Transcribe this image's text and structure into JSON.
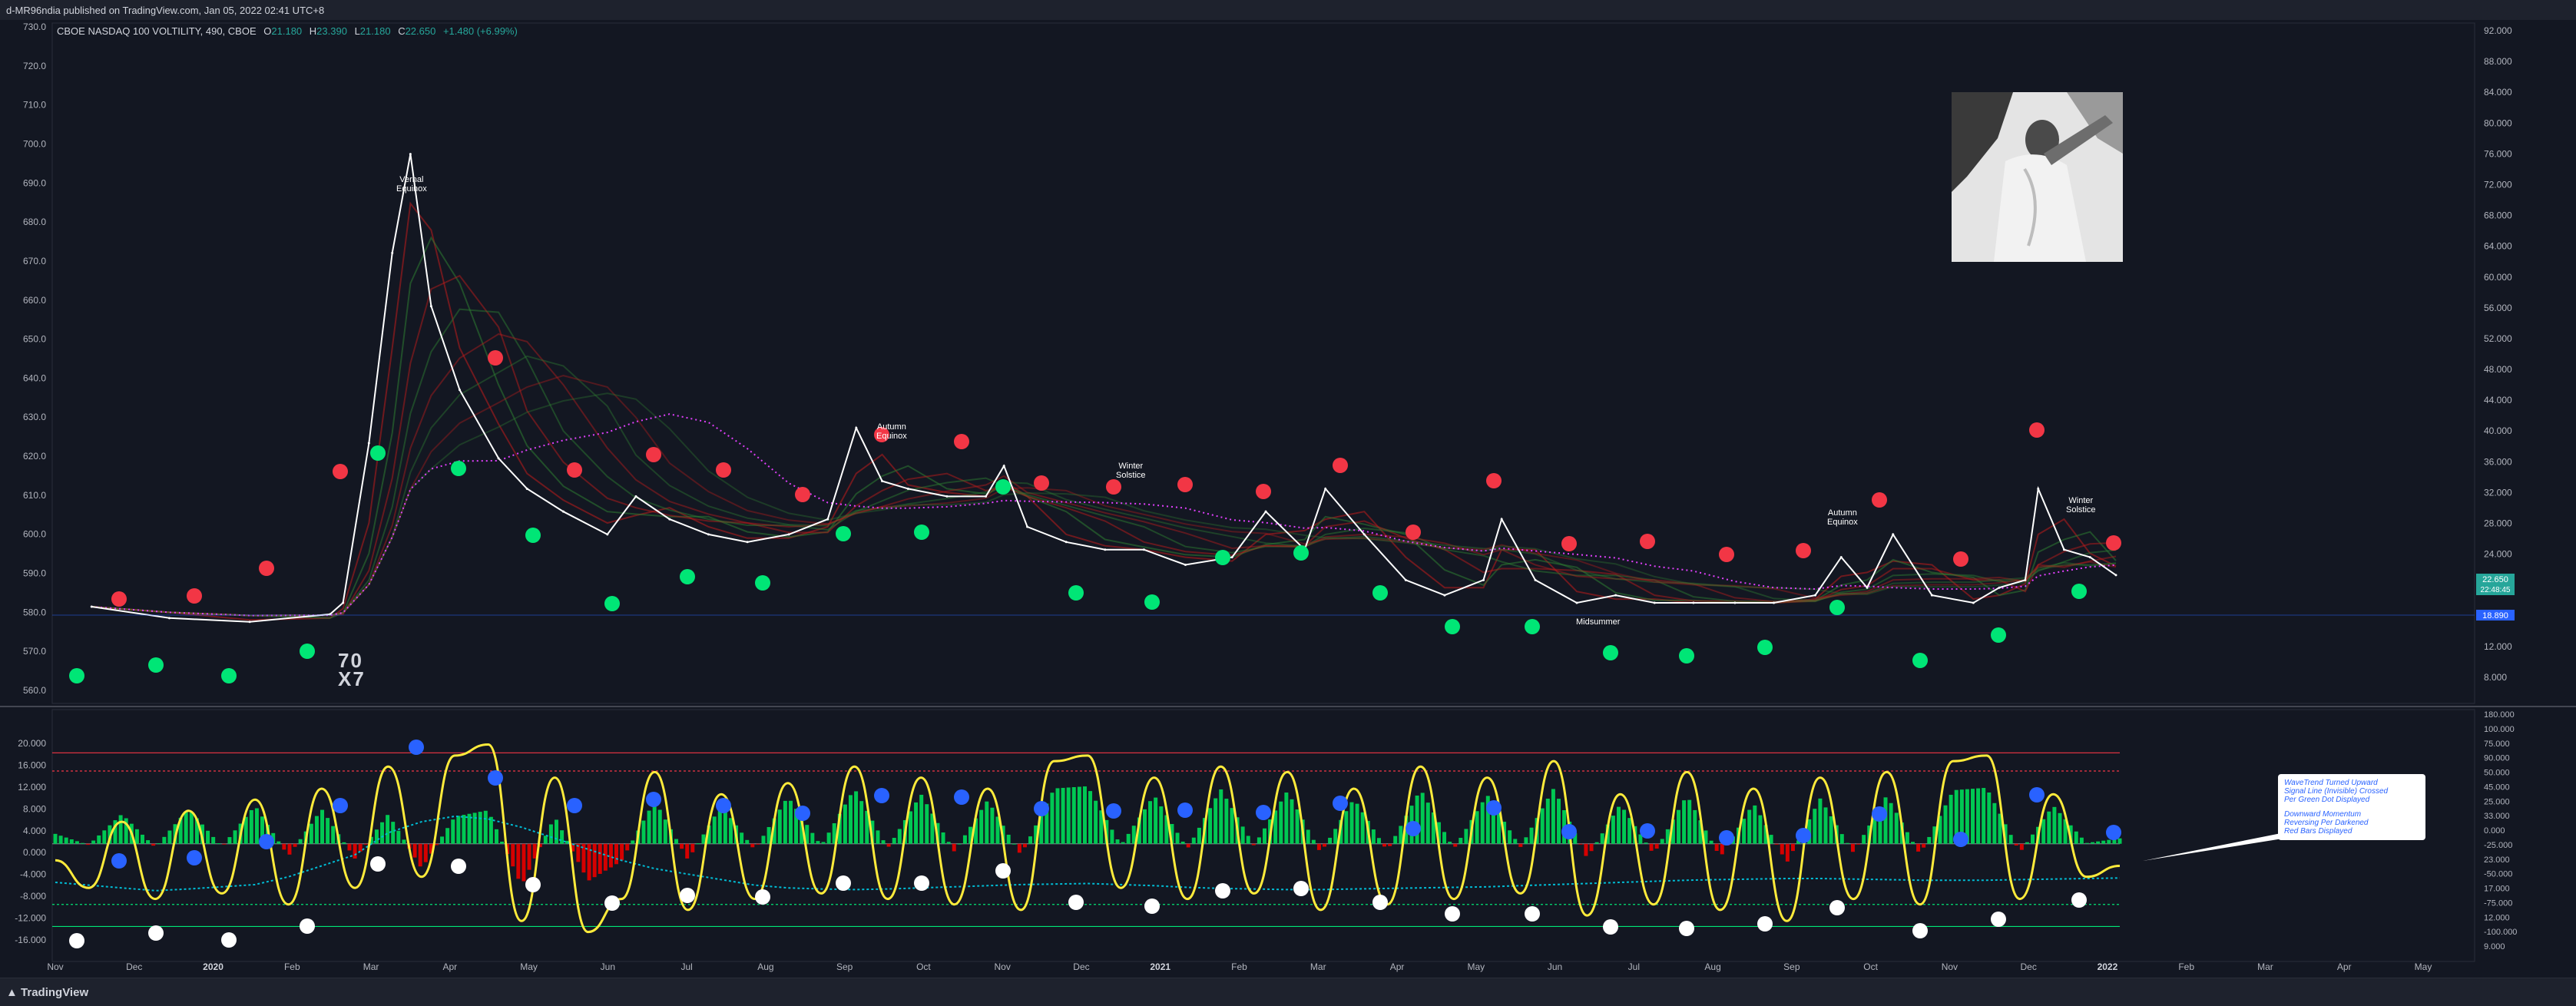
{
  "publisher": "d-MR96ndia published on TradingView.com, Jan 05, 2022 02:41 UTC+8",
  "logo_text": "TradingView",
  "legend": {
    "title": "CBOE NASDAQ 100 VOLTILITY, 490, CBOE",
    "o_label": "O",
    "o_value": "21.180",
    "h_label": "H",
    "h_value": "23.390",
    "l_label": "L",
    "l_value": "21.180",
    "c_label": "C",
    "c_value": "22.650",
    "change": "+1.480 (+6.99%)"
  },
  "watermark": "70\nX7",
  "annotations": {
    "vernal": "Vernal\nEquinox",
    "autumn1": "Autumn\nEquinox",
    "winter1": "Winter\nSolstice",
    "midsummer": "Midsummer",
    "autumn2": "Autumn\nEquinox",
    "winter2": "Winter\nSolstice"
  },
  "callout": {
    "line1": "WaveTrend Turned Upward",
    "line2": "Signal Line (Invisible) Crossed",
    "line3": "Per Green Dot Displayed",
    "line4": "Downward Momentum",
    "line5": "Reversing Per Darkened",
    "line6": "Red Bars Displayed"
  },
  "price_badges": {
    "last": "22.650",
    "timer": "22:48:45",
    "ma": "18.890"
  },
  "colors": {
    "background": "#131722",
    "price_line": "#ffffff",
    "bull": "#26a69a",
    "red_dot": "#f23645",
    "green_dot": "#00e676",
    "blue_dot": "#2962ff",
    "wave": "#ffeb3b",
    "signal": "#00bcd4",
    "ma_dotted": "#e040fb"
  },
  "chart_data": [
    {
      "type": "line",
      "title": "CBOE NASDAQ 100 VOLTILITY, 490, CBOE",
      "x_ticks": [
        "Nov",
        "Dec",
        "2020",
        "Feb",
        "Mar",
        "Apr",
        "May",
        "Jun",
        "Jul",
        "Aug",
        "Sep",
        "Oct",
        "Nov",
        "Dec",
        "2021",
        "Feb",
        "Mar",
        "Apr",
        "May",
        "Jun",
        "Jul",
        "Aug",
        "Sep",
        "Oct",
        "Nov",
        "Dec",
        "2022",
        "Feb",
        "Mar",
        "Apr",
        "May"
      ],
      "left_axis_ticks": [
        "730.0",
        "720.0",
        "710.0",
        "700.0",
        "690.0",
        "680.0",
        "670.0",
        "660.0",
        "650.0",
        "640.0",
        "630.0",
        "620.0",
        "610.0",
        "600.0",
        "590.0",
        "580.0",
        "570.0",
        "560.0"
      ],
      "right_axis_ticks": [
        "92.000",
        "88.000",
        "84.000",
        "80.000",
        "76.000",
        "72.000",
        "68.000",
        "64.000",
        "60.000",
        "56.000",
        "52.000",
        "48.000",
        "44.000",
        "40.000",
        "36.000",
        "32.000",
        "28.000",
        "24.000",
        "20.000",
        "16.000",
        "12.000",
        "8.000"
      ],
      "ylim": [
        8,
        93
      ],
      "series": [
        {
          "x": [
            "2019-11",
            "2019-12",
            "2020-01",
            "2020-02",
            "2020-02-20",
            "2020-03-01",
            "2020-03-10",
            "2020-03-17",
            "2020-03-25",
            "2020-04-05",
            "2020-04-20",
            "2020-05-01",
            "2020-05-15",
            "2020-06-01",
            "2020-06-12",
            "2020-06-25",
            "2020-07-10",
            "2020-07-25",
            "2020-08-10",
            "2020-08-25",
            "2020-09-05",
            "2020-09-15",
            "2020-09-25",
            "2020-10-10",
            "2020-10-25",
            "2020-11-01",
            "2020-11-10",
            "2020-11-25",
            "2020-12-10",
            "2020-12-25",
            "2021-01-10",
            "2021-01-28",
            "2021-02-10",
            "2021-02-25",
            "2021-03-05",
            "2021-03-20",
            "2021-04-05",
            "2021-04-20",
            "2021-05-05",
            "2021-05-12",
            "2021-05-25",
            "2021-06-10",
            "2021-06-25",
            "2021-07-10",
            "2021-07-25",
            "2021-08-10",
            "2021-08-25",
            "2021-09-10",
            "2021-09-20",
            "2021-09-30",
            "2021-10-10",
            "2021-10-25",
            "2021-11-10",
            "2021-11-20",
            "2021-11-30",
            "2021-12-05",
            "2021-12-15",
            "2021-12-25",
            "2022-01-04"
          ],
          "y": [
            18.5,
            17,
            16.5,
            17.5,
            19,
            40,
            65,
            78,
            58,
            47,
            38,
            34,
            31,
            28,
            33,
            30,
            28,
            27,
            28,
            30,
            42,
            35,
            34,
            33,
            33,
            37,
            29,
            27,
            26,
            26,
            24,
            25,
            31,
            26,
            34,
            28,
            22,
            20,
            22,
            30,
            22,
            19,
            20,
            19,
            19,
            19,
            19,
            20,
            25,
            21,
            28,
            20,
            19,
            21,
            22,
            34,
            26,
            25,
            22.65
          ]
        }
      ]
    },
    {
      "type": "bar",
      "title": "",
      "left_axis_ticks": [
        "20.000",
        "16.000",
        "12.000",
        "8.000",
        "4.000",
        "0.000",
        "-4.000",
        "-8.000",
        "-12.000",
        "-16.000"
      ],
      "right_axis_ticks": [
        "180.000",
        "100.000",
        "75.000",
        "90.000",
        "50.000",
        "45.000",
        "25.000",
        "33.000",
        "0.000",
        "-25.000",
        "23.000",
        "-50.000",
        "17.000",
        "-75.000",
        "12.000",
        "-100.000",
        "9.000"
      ],
      "ylim": [
        -18,
        21
      ],
      "reference_lines": [
        16.5,
        13.2,
        0,
        -11,
        -15
      ],
      "series": [
        {
          "name": "WaveTrend",
          "values": [
            -3,
            -8,
            4,
            -10,
            6,
            -9,
            8,
            -11,
            10,
            -8,
            14,
            -6,
            16,
            18,
            -14,
            12,
            -16,
            -10,
            13,
            -12,
            9,
            -10,
            11,
            -9,
            14,
            -10,
            12,
            -11,
            10,
            -12,
            15,
            16,
            -8,
            12,
            -10,
            14,
            -9,
            13,
            -12,
            10,
            -11,
            14,
            -10,
            12,
            -9,
            15,
            -13,
            9,
            -11,
            13,
            -12,
            10,
            -14,
            12,
            -10,
            13,
            -11,
            15,
            16,
            -10,
            9,
            -6,
            -4
          ]
        },
        {
          "name": "Signal",
          "values": [
            -7,
            -7.5,
            -8,
            -8.5,
            -8.2,
            -7.8,
            -7.4,
            -6,
            -4,
            -2,
            2,
            4,
            5,
            4.5,
            3,
            1,
            -1,
            -3,
            -4.5,
            -5.5,
            -6.5,
            -7.5,
            -8,
            -8.2,
            -8.3,
            -8.2,
            -8,
            -7.8,
            -7.6,
            -7.4,
            -7.3,
            -7.2,
            -7.4,
            -7.6,
            -7.9,
            -8.1,
            -8.2,
            -8.3,
            -8.3,
            -8.2,
            -8.1,
            -8,
            -7.9,
            -7.8,
            -7.6,
            -7.4,
            -7.2,
            -7,
            -6.8,
            -6.6,
            -6.5,
            -6.4,
            -6.3,
            -6.3,
            -6.4,
            -6.5,
            -6.6,
            -6.6,
            -6.6,
            -6.5,
            -6.4,
            -6.3,
            -6.2
          ]
        }
      ]
    }
  ]
}
